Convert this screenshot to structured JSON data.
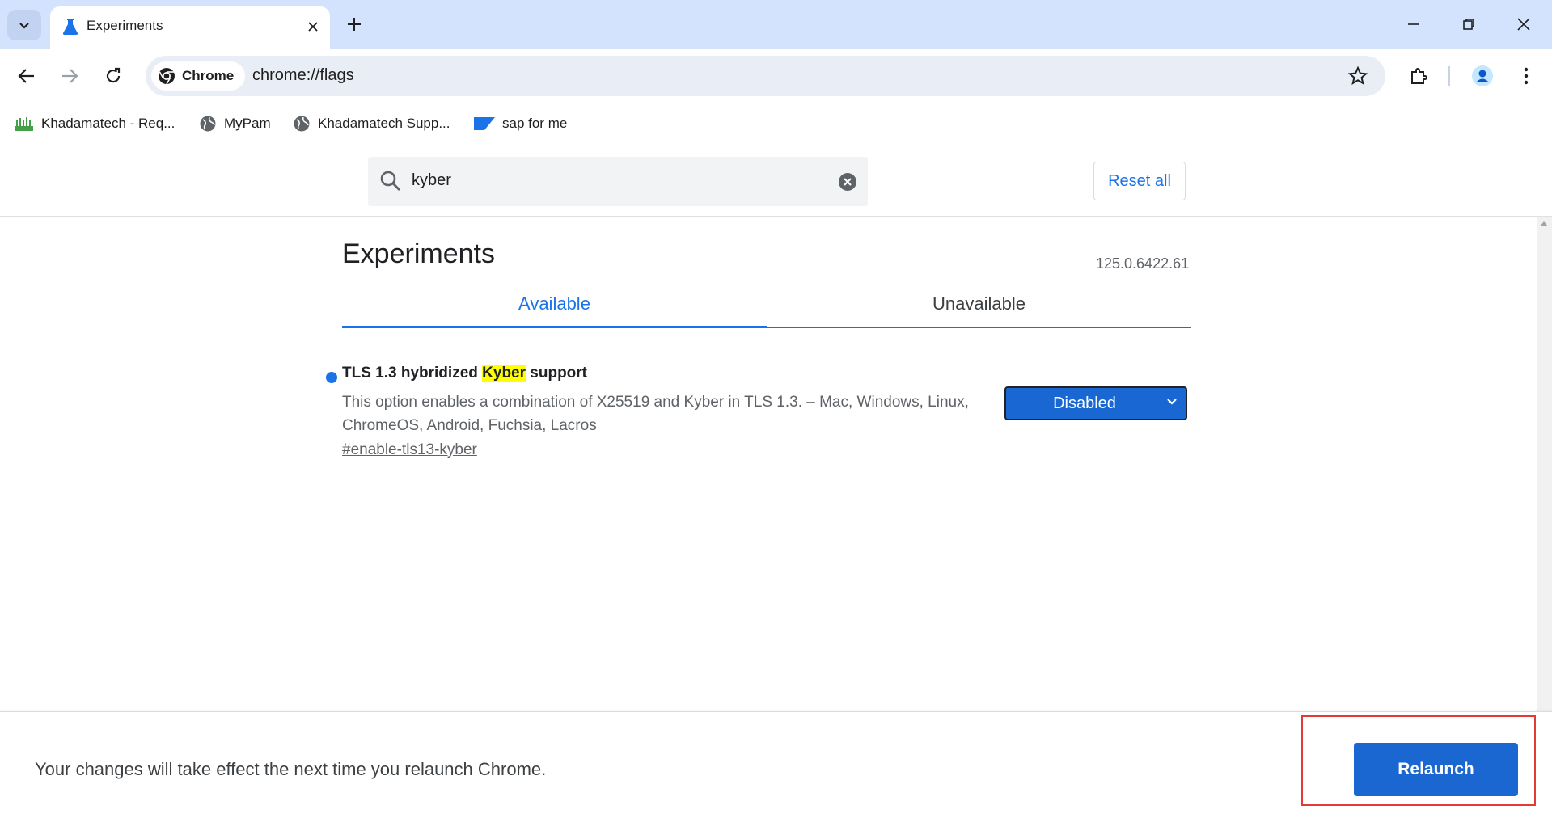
{
  "browser": {
    "tab": {
      "title": "Experiments",
      "favicon": "flask-icon"
    },
    "omnibox": {
      "chip_label": "Chrome",
      "url": "chrome://flags"
    },
    "bookmarks": [
      {
        "label": "Khadamatech - Req...",
        "icon": "khadamatech-icon"
      },
      {
        "label": "MyPam",
        "icon": "globe-icon"
      },
      {
        "label": "Khadamatech Supp...",
        "icon": "globe-icon"
      },
      {
        "label": "sap for me",
        "icon": "sap-icon"
      }
    ]
  },
  "flags": {
    "search": {
      "value": "kyber"
    },
    "reset_label": "Reset all",
    "heading": "Experiments",
    "version": "125.0.6422.61",
    "tabs": [
      "Available",
      "Unavailable"
    ],
    "experiment": {
      "title_before": "TLS 1.3 hybridized ",
      "title_highlight": "Kyber",
      "title_after": " support",
      "description": "This option enables a combination of X25519 and Kyber in TLS 1.3. – Mac, Windows, Linux, ChromeOS, Android, Fuchsia, Lacros",
      "link": "#enable-tls13-kyber",
      "selected_option": "Disabled"
    }
  },
  "footer": {
    "message": "Your changes will take effect the next time you relaunch Chrome.",
    "relaunch_label": "Relaunch"
  },
  "colors": {
    "accent": "#1a73e8",
    "tabstrip": "#d3e3fd",
    "highlight_box": "#e53935"
  }
}
